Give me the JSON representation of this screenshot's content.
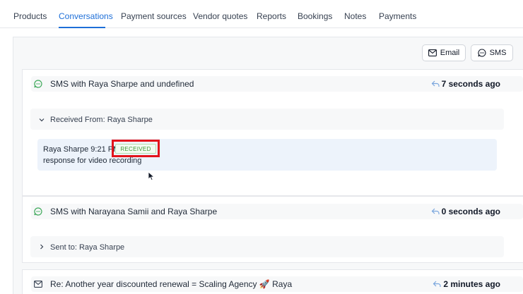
{
  "tabs": [
    {
      "label": "Products",
      "active": false
    },
    {
      "label": "Conversations",
      "active": true
    },
    {
      "label": "Payment sources",
      "active": false
    },
    {
      "label": "Vendor quotes",
      "active": false
    },
    {
      "label": "Reports",
      "active": false
    },
    {
      "label": "Bookings",
      "active": false
    },
    {
      "label": "Notes",
      "active": false
    },
    {
      "label": "Payments",
      "active": false
    }
  ],
  "actions": {
    "email_label": "Email",
    "sms_label": "SMS"
  },
  "conversations": [
    {
      "channel": "sms",
      "title": "SMS with Raya Sharpe and undefined",
      "time": "7 seconds ago",
      "detail": {
        "expanded": true,
        "label": "Received From: Raya Sharpe",
        "message": {
          "sender": "Raya Sharpe",
          "time": "9:21 PM",
          "status": "RECEIVED",
          "body": "response for video recording"
        }
      }
    },
    {
      "channel": "sms",
      "title": "SMS with Narayana Samii and Raya Sharpe",
      "time": "0 seconds ago",
      "detail": {
        "expanded": false,
        "label": "Sent to: Raya Sharpe"
      }
    },
    {
      "channel": "email",
      "title": "Re: Another year discounted renewal = Scaling Agency 🚀 Raya",
      "time": "2 minutes ago"
    }
  ],
  "colors": {
    "accent": "#1e6fd8",
    "sms_icon": "#3aa757",
    "received_badge": "#3f9a35",
    "highlight_frame": "#e3141b",
    "reply_icon": "#7aa6dd"
  },
  "icons": {
    "sms": "chat-bubble-icon",
    "email": "envelope-icon",
    "reply": "reply-arrow-icon",
    "expanded": "chevron-down-icon",
    "collapsed": "chevron-right-icon"
  }
}
